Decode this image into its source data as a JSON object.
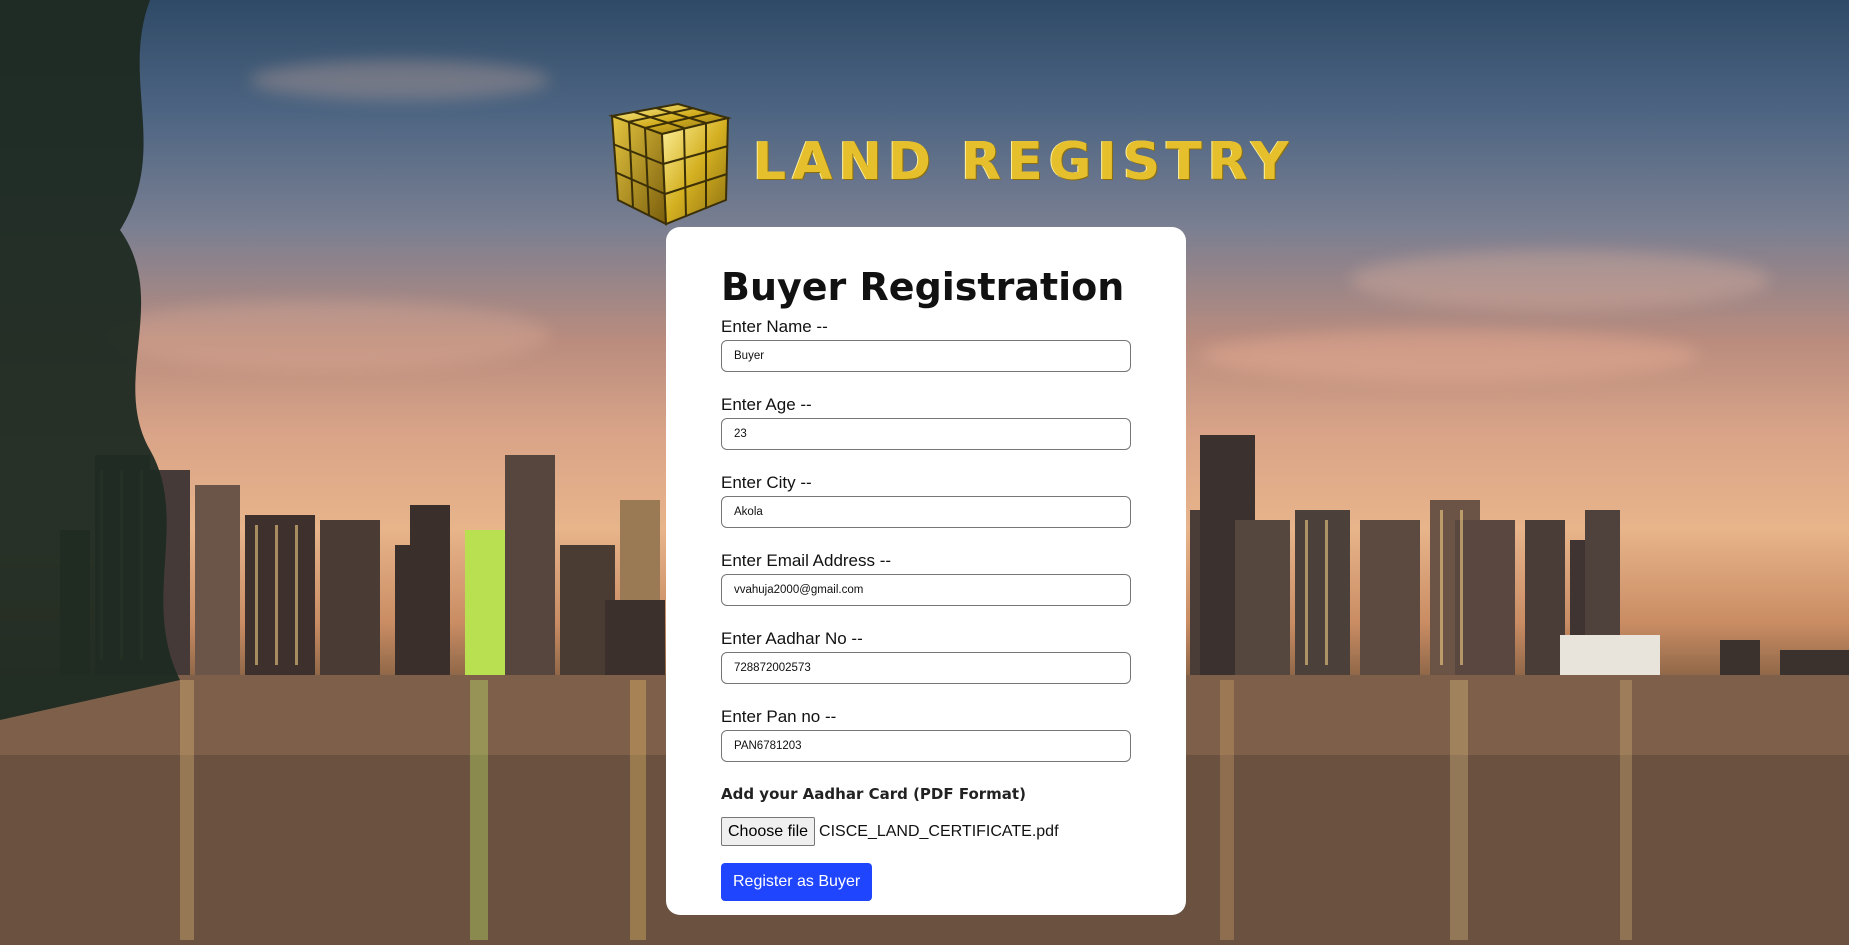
{
  "app": {
    "logo_text": "LAND REGISTRY"
  },
  "form": {
    "title": "Buyer Registration",
    "fields": [
      {
        "label": "Enter Name --",
        "value": "Buyer"
      },
      {
        "label": "Enter Age --",
        "value": "23"
      },
      {
        "label": "Enter City --",
        "value": "Akola"
      },
      {
        "label": "Enter Email Address --",
        "value": "vvahuja2000@gmail.com"
      },
      {
        "label": "Enter Aadhar No --",
        "value": "728872002573"
      },
      {
        "label": "Enter Pan no --",
        "value": "PAN6781203"
      }
    ],
    "file": {
      "title": "Add your Aadhar Card (PDF Format)",
      "button_label": "Choose file",
      "file_name": "CISCE_LAND_CERTIFICATE.pdf"
    },
    "submit_label": "Register as Buyer"
  },
  "colors": {
    "primary_button": "#2045ff",
    "logo_gold": "#e6c02c",
    "card_background": "#ffffff"
  },
  "icons": {
    "logo": "gold-cube-icon"
  }
}
